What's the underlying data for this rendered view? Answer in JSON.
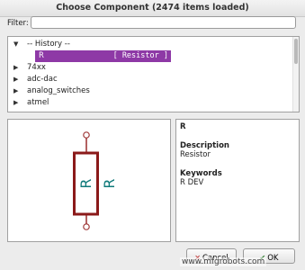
{
  "window": {
    "title": "Choose Component (2474 items loaded)"
  },
  "filter": {
    "label": "Filter:",
    "value": ""
  },
  "tree": {
    "history_label": "-- History --",
    "selected": {
      "name": "R",
      "type": "[ Resistor ]"
    },
    "libraries": [
      "74xx",
      "adc-dac",
      "analog_switches",
      "atmel"
    ]
  },
  "preview": {
    "ref_label": "R",
    "value_label": "R"
  },
  "info": {
    "name": "R",
    "description_heading": "Description",
    "description": "Resistor",
    "keywords_heading": "Keywords",
    "keywords": "R DEV"
  },
  "buttons": {
    "cancel": "Cancel",
    "ok": "OK"
  },
  "watermark": "www.mfgrobots.com",
  "colors": {
    "selection": "#8e39a6",
    "symbol": "#8b1a1a",
    "pin": "#a03a3a"
  }
}
